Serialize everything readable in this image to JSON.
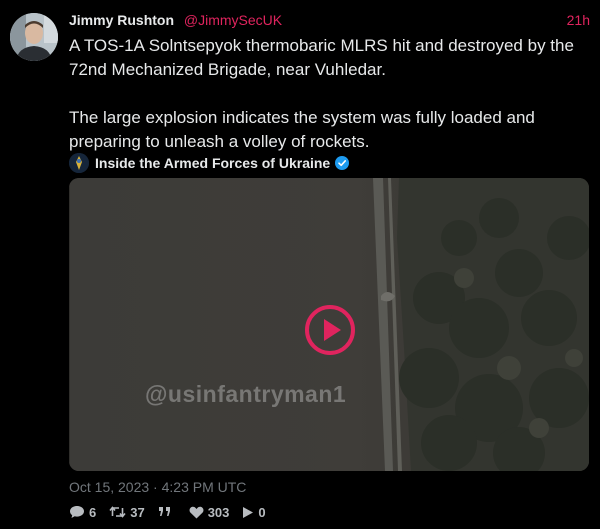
{
  "author": {
    "name": "Jimmy Rushton",
    "handle": "@JimmySecUK",
    "time_ago": "21h"
  },
  "body": {
    "paragraph1": "A TOS-1A Solntsepyok thermobaric MLRS hit and destroyed by the 72nd Mechanized Brigade, near Vuhledar.",
    "paragraph2": "The large explosion indicates the system was fully loaded and preparing to unleash a volley of rockets."
  },
  "quoted_account": {
    "name": "Inside the Armed Forces of Ukraine",
    "verified_icon": "verified-badge-icon"
  },
  "media": {
    "watermark": "@usinfantryman1",
    "play_icon": "play-icon"
  },
  "date_line": "Oct 15, 2023 · 4:23 PM UTC",
  "stats": {
    "replies": "6",
    "retweets": "37",
    "likes": "303",
    "views": "0",
    "icons": [
      "reply-icon",
      "retweet-icon",
      "quote-icon",
      "heart-icon",
      "play-views-icon"
    ]
  },
  "colors": {
    "accent": "#e0245e",
    "background": "#000000",
    "text": "#e7e9ea",
    "muted": "#71767b",
    "verified": "#1d9bf0"
  }
}
